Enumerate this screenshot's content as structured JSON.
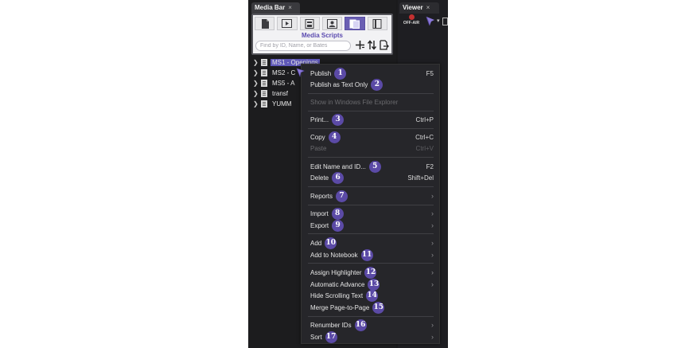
{
  "tabs": {
    "media_bar": "Media Bar",
    "viewer": "Viewer",
    "close": "×"
  },
  "panel": {
    "title": "Media Scripts",
    "search_placeholder": "Find by ID, Name, or Bates",
    "toolbar_icons": [
      "document-icon",
      "play-icon",
      "doc-frame-icon",
      "portrait-icon",
      "media-scripts-icon",
      "scroll-icon"
    ],
    "active_tab_index": 4
  },
  "tree": [
    {
      "label": "MS1 - Openings",
      "selected": true
    },
    {
      "label": "MS2 - C"
    },
    {
      "label": "MS5 - A"
    },
    {
      "label": "transf"
    },
    {
      "label": "YUMM"
    }
  ],
  "viewer": {
    "off_air": "OFF-AIR"
  },
  "menu": {
    "items": [
      {
        "label": "Publish",
        "shortcut": "F5",
        "badge": "1"
      },
      {
        "label": "Publish as Text Only",
        "shortcut": "",
        "badge": "2"
      },
      {
        "label": "Show in Windows File Explorer",
        "disabled": true
      },
      {
        "label": "Print...",
        "shortcut": "Ctrl+P",
        "badge": "3"
      },
      {
        "label": "Copy",
        "shortcut": "Ctrl+C",
        "badge": "4"
      },
      {
        "label": "Paste",
        "shortcut": "Ctrl+V",
        "disabled": true
      },
      {
        "label": "Edit Name and ID...",
        "shortcut": "F2",
        "badge": "5"
      },
      {
        "label": "Delete",
        "shortcut": "Shift+Del",
        "badge": "6"
      },
      {
        "label": "Reports",
        "submenu": true,
        "badge": "7"
      },
      {
        "label": "Import",
        "submenu": true,
        "badge": "8"
      },
      {
        "label": "Export",
        "submenu": true,
        "badge": "9"
      },
      {
        "label": "Add",
        "submenu": true,
        "badge": "10"
      },
      {
        "label": "Add to Notebook",
        "submenu": true,
        "badge": "11"
      },
      {
        "label": "Assign Highlighter",
        "submenu": true,
        "badge": "12"
      },
      {
        "label": "Automatic Advance",
        "submenu": true,
        "badge": "13"
      },
      {
        "label": "Hide Scrolling Text",
        "badge": "14"
      },
      {
        "label": "Merge Page-to-Page",
        "badge": "15"
      },
      {
        "label": "Renumber IDs",
        "submenu": true,
        "badge": "16"
      },
      {
        "label": "Sort",
        "submenu": true,
        "badge": "17"
      }
    ]
  }
}
